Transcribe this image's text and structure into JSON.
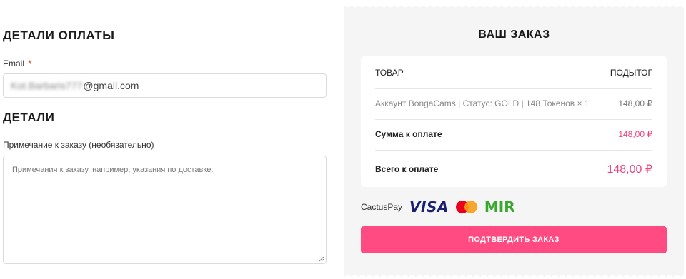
{
  "billing": {
    "heading": "ДЕТАЛИ ОПЛАТЫ",
    "email_label": "Email",
    "required_mark": "*",
    "email_value_local": "Kot.Barbaris777",
    "email_value_domain": "@gmail.com"
  },
  "details": {
    "heading": "ДЕТАЛИ",
    "notes_label": "Примечание к заказу (необязательно)",
    "notes_placeholder": "Примечания к заказу, например, указания по доставке."
  },
  "order": {
    "heading": "ВАШ ЗАКАЗ",
    "col_product": "ТОВАР",
    "col_subtotal": "ПОДЫТОГ",
    "item_name": "Аккаунт BongaCams | Статус: GOLD | 148 Токенов",
    "item_qty": "× 1",
    "item_price": "148,00 ₽",
    "subtotal_label": "Сумма к оплате",
    "subtotal_value": "148,00 ₽",
    "total_label": "Всего к оплате",
    "total_value": "148,00 ₽"
  },
  "payment": {
    "method_label": "CactusPay",
    "logos": {
      "visa": "VISA",
      "mastercard": "mastercard-logo",
      "mir": "MIR"
    },
    "confirm_label": "ПОДТВЕРДИТЬ ЗАКАЗ"
  },
  "colors": {
    "accent": "#ff4b82",
    "price_accent": "#f0437a",
    "panel_bg": "#f5f5f5",
    "visa_blue": "#1a1f71",
    "mir_green": "#37a72e"
  }
}
